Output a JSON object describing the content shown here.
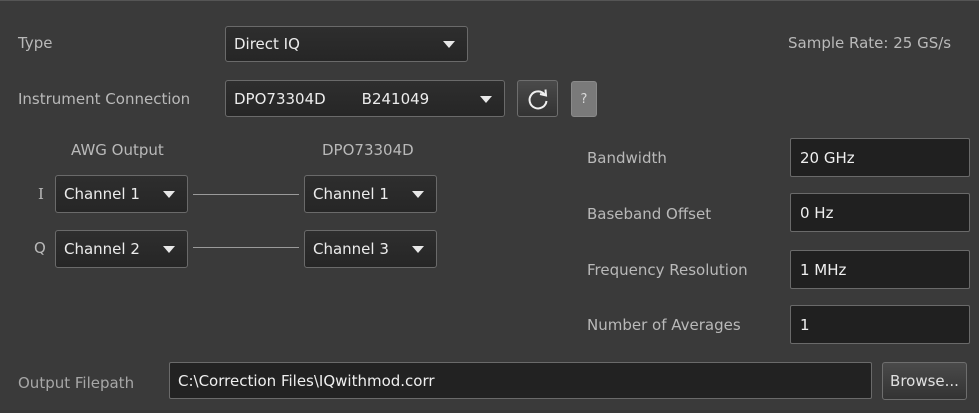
{
  "type_row": {
    "label": "Type",
    "value": "Direct IQ"
  },
  "sample_rate": {
    "label": "Sample Rate:",
    "value": "25 GS/s"
  },
  "instrument": {
    "label": "Instrument Connection",
    "model": "DPO73304D",
    "serial": "B241049",
    "help_label": "?"
  },
  "mapping": {
    "awg_header": "AWG Output",
    "scope_header": "DPO73304D",
    "rows": [
      {
        "label": "I",
        "awg": "Channel 1",
        "scope": "Channel 1"
      },
      {
        "label": "Q",
        "awg": "Channel 2",
        "scope": "Channel 3"
      }
    ]
  },
  "settings": [
    {
      "label": "Bandwidth",
      "value": "20 GHz"
    },
    {
      "label": "Baseband Offset",
      "value": "0 Hz"
    },
    {
      "label": "Frequency Resolution",
      "value": "1 MHz"
    },
    {
      "label": "Number of Averages",
      "value": "1"
    }
  ],
  "output": {
    "label": "Output Filepath",
    "value": "C:\\Correction Files\\IQwithmod.corr",
    "browse_label": "Browse..."
  }
}
